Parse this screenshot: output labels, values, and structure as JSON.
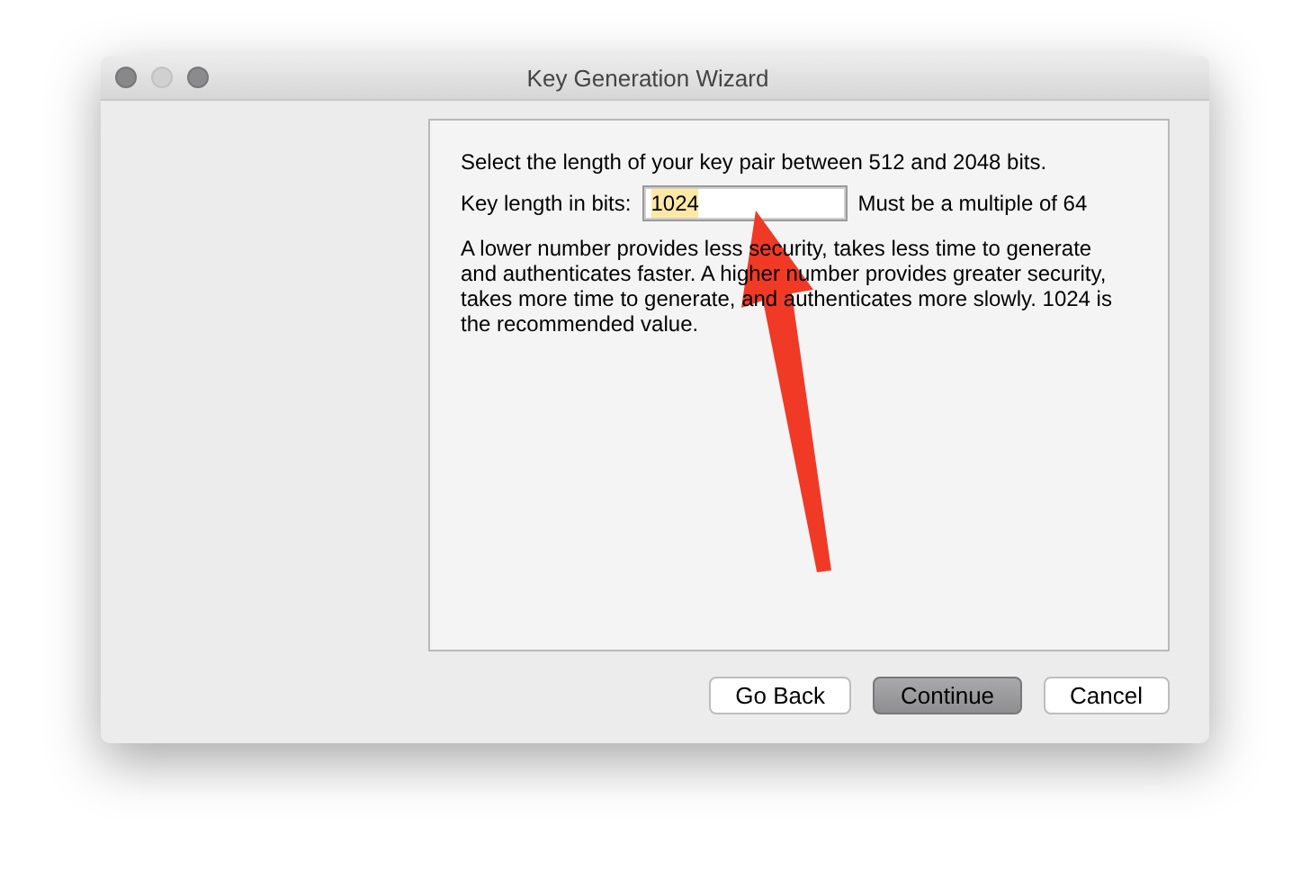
{
  "window": {
    "title": "Key Generation Wizard",
    "controls": [
      {
        "kind": "close",
        "disabled": false
      },
      {
        "kind": "minimize",
        "disabled": true
      },
      {
        "kind": "zoom",
        "disabled": false
      }
    ]
  },
  "panel": {
    "instruction": "Select the length of your key pair between 512 and 2048 bits.",
    "field_label": "Key length in bits:",
    "field_value": "1024",
    "value_selected": true,
    "field_hint": "Must be a multiple of 64",
    "description": "A lower number provides less security, takes less time to generate and authenticates faster. A higher number provides greater security, takes more time to generate, and authenticates more slowly. 1024 is the recommended value."
  },
  "buttons": [
    {
      "label": "Go Back",
      "default": false
    },
    {
      "label": "Continue",
      "default": true
    },
    {
      "label": "Cancel",
      "default": false
    }
  ],
  "annotation": {
    "kind": "arrow"
  }
}
